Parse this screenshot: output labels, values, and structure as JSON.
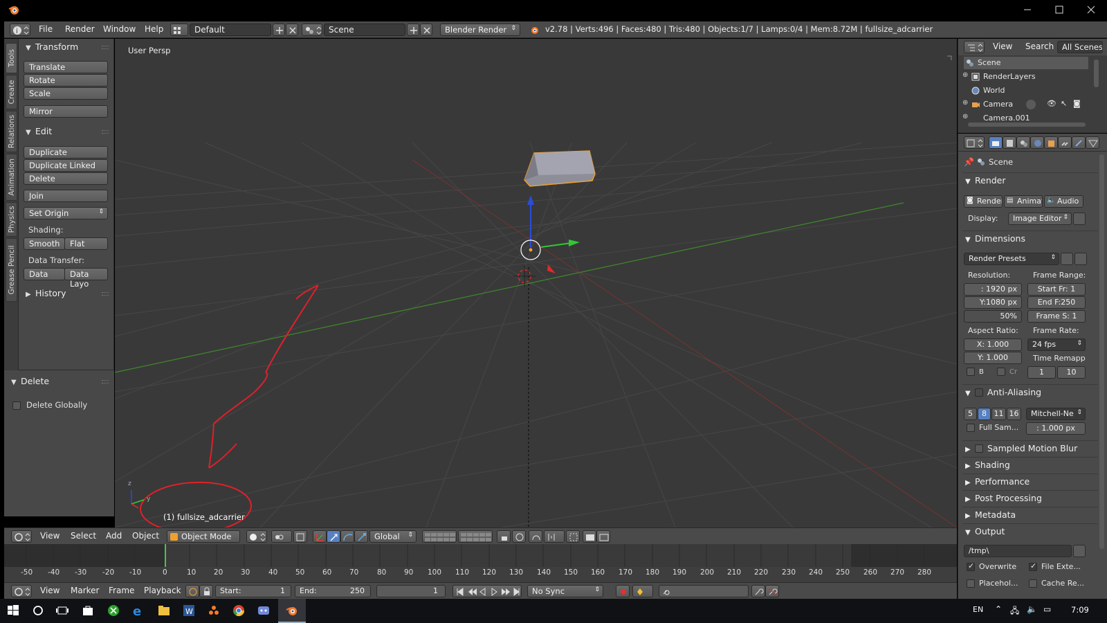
{
  "titlebar": {
    "minimize": "—",
    "maximize": "□",
    "close": "✕"
  },
  "infobar": {
    "menus": [
      "File",
      "Render",
      "Window",
      "Help"
    ],
    "layout": "Default",
    "scene": "Scene",
    "engine": "Blender Render",
    "stats": "v2.78 | Verts:496 | Faces:480 | Tris:480 | Objects:1/7 | Lamps:0/4 | Mem:8.72M | fullsize_adcarrier"
  },
  "vtabs": [
    "Tools",
    "Create",
    "Relations",
    "Animation",
    "Physics",
    "Grease Pencil"
  ],
  "toolshelf": {
    "transform_title": "Transform",
    "translate": "Translate",
    "rotate": "Rotate",
    "scale": "Scale",
    "mirror": "Mirror",
    "edit_title": "Edit",
    "duplicate": "Duplicate",
    "duplicate_linked": "Duplicate Linked",
    "delete": "Delete",
    "join": "Join",
    "set_origin": "Set Origin",
    "shading_label": "Shading:",
    "smooth": "Smooth",
    "flat": "Flat",
    "data_transfer_label": "Data Transfer:",
    "data": "Data",
    "data_layo": "Data Layo",
    "history_title": "History",
    "op_title": "Delete",
    "delete_globally": "Delete Globally"
  },
  "viewport": {
    "view_label": "User Persp",
    "object_label": "(1) fullsize_adcarrier",
    "axis_z": "z",
    "axis_y": "y"
  },
  "vheader": {
    "menus": [
      "View",
      "Select",
      "Add",
      "Object"
    ],
    "mode": "Object Mode",
    "orientation": "Global"
  },
  "timeline": {
    "ticks": [
      "-50",
      "-40",
      "-30",
      "-20",
      "-10",
      "0",
      "10",
      "20",
      "30",
      "40",
      "50",
      "60",
      "70",
      "80",
      "90",
      "100",
      "110",
      "120",
      "130",
      "140",
      "150",
      "160",
      "170",
      "180",
      "190",
      "200",
      "210",
      "220",
      "230",
      "240",
      "250",
      "260",
      "270",
      "280"
    ],
    "current_frame": 0
  },
  "tlheader": {
    "menus": [
      "View",
      "Marker",
      "Frame",
      "Playback"
    ],
    "start_label": "Start:",
    "start_value": "1",
    "end_label": "End:",
    "end_value": "250",
    "current": "1",
    "sync": "No Sync"
  },
  "outliner": {
    "menus": [
      "View",
      "Search"
    ],
    "filter": "All Scenes",
    "items": [
      "Scene",
      "RenderLayers",
      "World",
      "Camera",
      "Camera.001"
    ]
  },
  "props": {
    "breadcrumb": "Scene",
    "render_title": "Render",
    "render_btn": "Render",
    "animation_btn": "Animati",
    "audio_btn": "Audio",
    "display_label": "Display:",
    "display_value": "Image Editor",
    "dimensions_title": "Dimensions",
    "presets": "Render Presets",
    "resolution_label": "Resolution:",
    "res_x": ": 1920 px",
    "res_y": "Y:1080 px",
    "res_pct": "50%",
    "frame_range_label": "Frame Range:",
    "start_fr": "Start Fr: 1",
    "end_f": "End F:250",
    "frame_s": "Frame S: 1",
    "aspect_label": "Aspect Ratio:",
    "aspect_x": "X:  1.000",
    "aspect_y": "Y:  1.000",
    "frame_rate_label": "Frame Rate:",
    "fps": "24 fps",
    "time_remap_label": "Time Remapp",
    "b_label": "B",
    "cr_label": "Cr",
    "remap_old": "1",
    "remap_new": "10",
    "aa_title": "Anti-Aliasing",
    "aa_samples": [
      "5",
      "8",
      "11",
      "16"
    ],
    "aa_filter": "Mitchell-Ne",
    "full_sample": "Full Sam...",
    "filter_size": ": 1.000 px",
    "motion_blur_title": "Sampled Motion Blur",
    "shading_title": "Shading",
    "performance_title": "Performance",
    "post_title": "Post Processing",
    "metadata_title": "Metadata",
    "output_title": "Output",
    "output_path": "/tmp\\",
    "overwrite": "Overwrite",
    "file_ext": "File Exte...",
    "placeholders": "Placehol...",
    "cache": "Cache Re..."
  },
  "taskbar": {
    "lang": "EN",
    "time": "7:09"
  },
  "colors": {
    "annotation": "#e0202a",
    "accent_blue": "#5680c2",
    "object_outline": "#f0a030"
  }
}
